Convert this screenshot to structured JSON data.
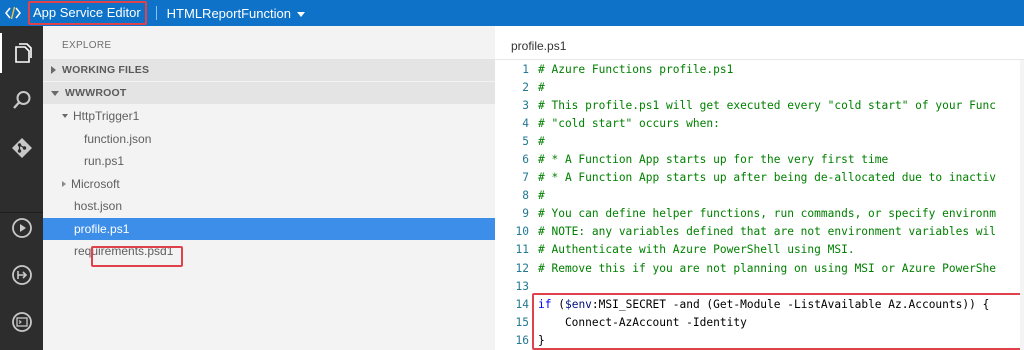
{
  "topbar": {
    "app_title": "App Service Editor",
    "function_name": "HTMLReportFunction",
    "colors": {
      "bg": "#0e72c8",
      "highlight": "#e0424c"
    }
  },
  "activity_icons": [
    "files-icon",
    "search-icon",
    "git-icon",
    "run-icon",
    "logout-icon",
    "console-icon"
  ],
  "explorer": {
    "header": "EXPLORE",
    "working_files": "WORKING FILES",
    "root": "WWWROOT",
    "tree": [
      {
        "label": "HttpTrigger1",
        "level": 1,
        "type": "folder-open"
      },
      {
        "label": "function.json",
        "level": 2,
        "type": "file"
      },
      {
        "label": "run.ps1",
        "level": 2,
        "type": "file"
      },
      {
        "label": "Microsoft",
        "level": 1,
        "type": "folder-closed"
      },
      {
        "label": "host.json",
        "level": 1,
        "type": "file"
      },
      {
        "label": "profile.ps1",
        "level": 1,
        "type": "file",
        "selected": true
      },
      {
        "label": "requirements.psd1",
        "level": 1,
        "type": "file"
      }
    ]
  },
  "editor": {
    "tab": "profile.ps1",
    "lines": [
      {
        "n": "1",
        "text": "# Azure Functions profile.ps1"
      },
      {
        "n": "2",
        "text": "#"
      },
      {
        "n": "3",
        "text": "# This profile.ps1 will get executed every \"cold start\" of your Func"
      },
      {
        "n": "4",
        "text": "# \"cold start\" occurs when:"
      },
      {
        "n": "5",
        "text": "#"
      },
      {
        "n": "6",
        "text": "# * A Function App starts up for the very first time"
      },
      {
        "n": "7",
        "text": "# * A Function App starts up after being de-allocated due to inactiv"
      },
      {
        "n": "8",
        "text": "#"
      },
      {
        "n": "9",
        "text": "# You can define helper functions, run commands, or specify environm"
      },
      {
        "n": "10",
        "text": "# NOTE: any variables defined that are not environment variables wil"
      },
      {
        "n": "11",
        "text": "# Authenticate with Azure PowerShell using MSI."
      },
      {
        "n": "12",
        "text": "# Remove this if you are not planning on using MSI or Azure PowerShe"
      },
      {
        "n": "13",
        "text": ""
      },
      {
        "n": "14",
        "kw": "if",
        "pre": " (",
        "var": "$env",
        "post": ":MSI_SECRET -and (Get-Module -ListAvailable Az.Accounts)) {"
      },
      {
        "n": "15",
        "code": "    Connect-AzAccount -Identity"
      },
      {
        "n": "16",
        "code": "}"
      }
    ]
  }
}
